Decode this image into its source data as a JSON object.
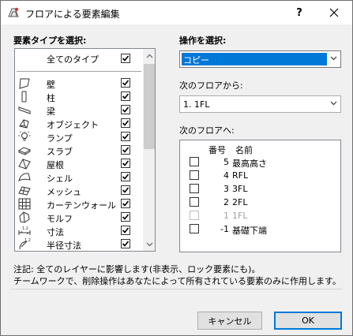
{
  "window": {
    "title": "フロアによる要素編集",
    "help_label": "?",
    "close_icon": "close-icon"
  },
  "element_types": {
    "heading": "要素タイプを選択:",
    "all_label": "全てのタイプ",
    "all_checked": true,
    "items": [
      {
        "label": "壁",
        "icon": "wall-icon",
        "checked": true
      },
      {
        "label": "柱",
        "icon": "column-icon",
        "checked": true
      },
      {
        "label": "梁",
        "icon": "beam-icon",
        "checked": true
      },
      {
        "label": "オブジェクト",
        "icon": "object-icon",
        "checked": true
      },
      {
        "label": "ランプ",
        "icon": "lamp-icon",
        "checked": true
      },
      {
        "label": "スラブ",
        "icon": "slab-icon",
        "checked": true
      },
      {
        "label": "屋根",
        "icon": "roof-icon",
        "checked": true
      },
      {
        "label": "シェル",
        "icon": "shell-icon",
        "checked": true
      },
      {
        "label": "メッシュ",
        "icon": "mesh-icon",
        "checked": true
      },
      {
        "label": "カーテンウォール",
        "icon": "curtain-wall-icon",
        "checked": true
      },
      {
        "label": "モルフ",
        "icon": "morph-icon",
        "checked": true
      },
      {
        "label": "寸法",
        "icon": "dimension-icon",
        "checked": true
      },
      {
        "label": "半径寸法",
        "icon": "radial-dimension-icon",
        "checked": true
      }
    ]
  },
  "operation": {
    "heading": "操作を選択:",
    "selected": "コピー"
  },
  "from_floor": {
    "label": "次のフロアから:",
    "selected": "1. 1FL"
  },
  "to_floor": {
    "label": "次のフロアへ:",
    "col_number": "番号",
    "col_name": "名前",
    "rows": [
      {
        "number": "5",
        "name": "最高高さ",
        "checked": false,
        "enabled": true
      },
      {
        "number": "4",
        "name": "RFL",
        "checked": false,
        "enabled": true
      },
      {
        "number": "3",
        "name": "3FL",
        "checked": false,
        "enabled": true
      },
      {
        "number": "2",
        "name": "2FL",
        "checked": false,
        "enabled": true
      },
      {
        "number": "1",
        "name": "1FL",
        "checked": false,
        "enabled": false
      },
      {
        "number": "-1",
        "name": "基礎下端",
        "checked": false,
        "enabled": true
      }
    ]
  },
  "notes": {
    "line1": "注記: 全てのレイヤーに影響します(非表示、ロック要素にも)。",
    "line2": "チームワークで、削除操作はあなたによって所有されている要素のみに作用します。"
  },
  "buttons": {
    "cancel": "キャンセル",
    "ok": "OK"
  },
  "colors": {
    "accent": "#0078d7",
    "window_bg": "#f0f0f0",
    "disabled_text": "#a0a0a0"
  }
}
